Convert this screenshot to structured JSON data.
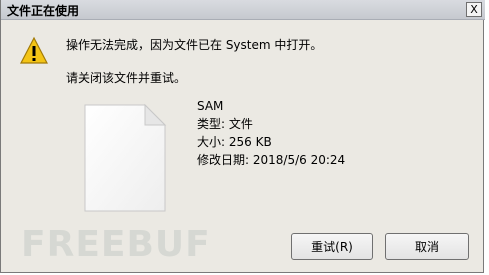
{
  "dialog": {
    "title": "文件正在使用",
    "close_label": "X",
    "message_line1": "操作无法完成，因为文件已在 System 中打开。",
    "message_line2": "请关闭该文件并重试。",
    "file": {
      "name": "SAM",
      "type_line": "类型: 文件",
      "size_line": "大小: 256 KB",
      "modified_line": "修改日期: 2018/5/6 20:24"
    },
    "buttons": {
      "retry": "重试(R)",
      "cancel": "取消"
    },
    "watermark": "FREEBUF"
  }
}
